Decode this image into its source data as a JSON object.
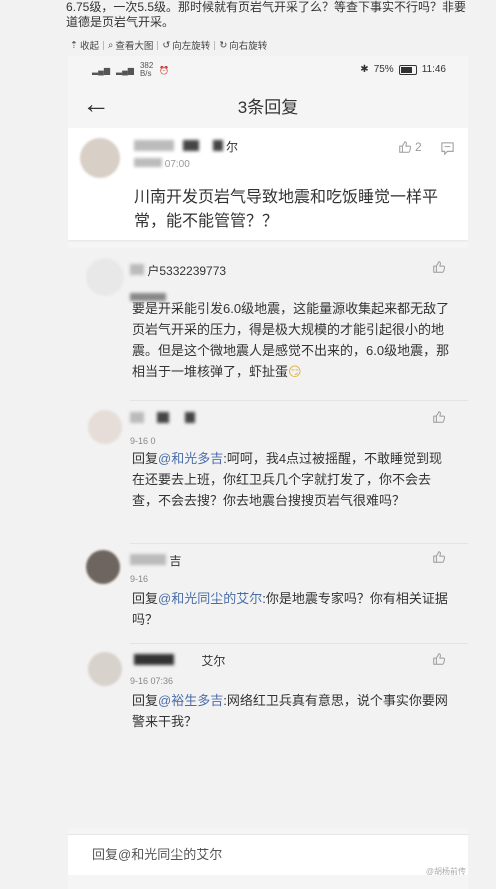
{
  "page": {
    "top_text": "6.75级，一次5.5级。那时候就有页岩气开采了么？等查下事实不行吗？非要道德是页岩气开采。",
    "toolbar": {
      "collapse": "收起",
      "view_large": "查看大图",
      "rotate_left": "向左旋转",
      "rotate_right": "向右旋转"
    }
  },
  "statusbar": {
    "net_speed_top": "382",
    "net_speed_unit": "B/s",
    "battery": "75%",
    "time": "11:46"
  },
  "header": {
    "title": "3条回复"
  },
  "main_comment": {
    "name_tail": "尔",
    "like_count": "2",
    "time": "07:00",
    "text": "川南开发页岩气导致地震和吃饭睡觉一样平常，能不能管管？？"
  },
  "replies": [
    {
      "name": "户5332239773",
      "time": "",
      "text": "要是开采能引发6.0级地震，这能量源收集起来都无敌了页岩气开采的压力，得是极大规模的才能引起很小的地震。但是这个微地震人是感觉不出来的，6.0级地震，那相当于一堆核弹了，虾扯蛋"
    },
    {
      "name": "",
      "time": "9-16 0",
      "reply_prefix": "回复",
      "mention": "@和光多吉",
      "text": ":呵呵，我4点过被摇醒，不敢睡觉到现在还要去上班，你红卫兵几个字就打发了，你不会去查，不会去搜？你去地震台搜搜页岩气很难吗？"
    },
    {
      "name": "吉",
      "time": "9-16",
      "reply_prefix": "回复",
      "mention": "@和光同尘的艾尔",
      "text": ":你是地震专家吗？你有相关证据吗？"
    },
    {
      "name": "艾尔",
      "time": "9-16 07:36",
      "reply_prefix": "回复",
      "mention": "@裕生多吉",
      "text": ":网络红卫兵真有意思，说个事实你要网警来干我？"
    }
  ],
  "input": {
    "placeholder": "回复@和光同尘的艾尔"
  },
  "watermark": "@胡杨前传",
  "colors": {
    "mention": "#4a6ea9",
    "background": "#f2f2f2"
  }
}
